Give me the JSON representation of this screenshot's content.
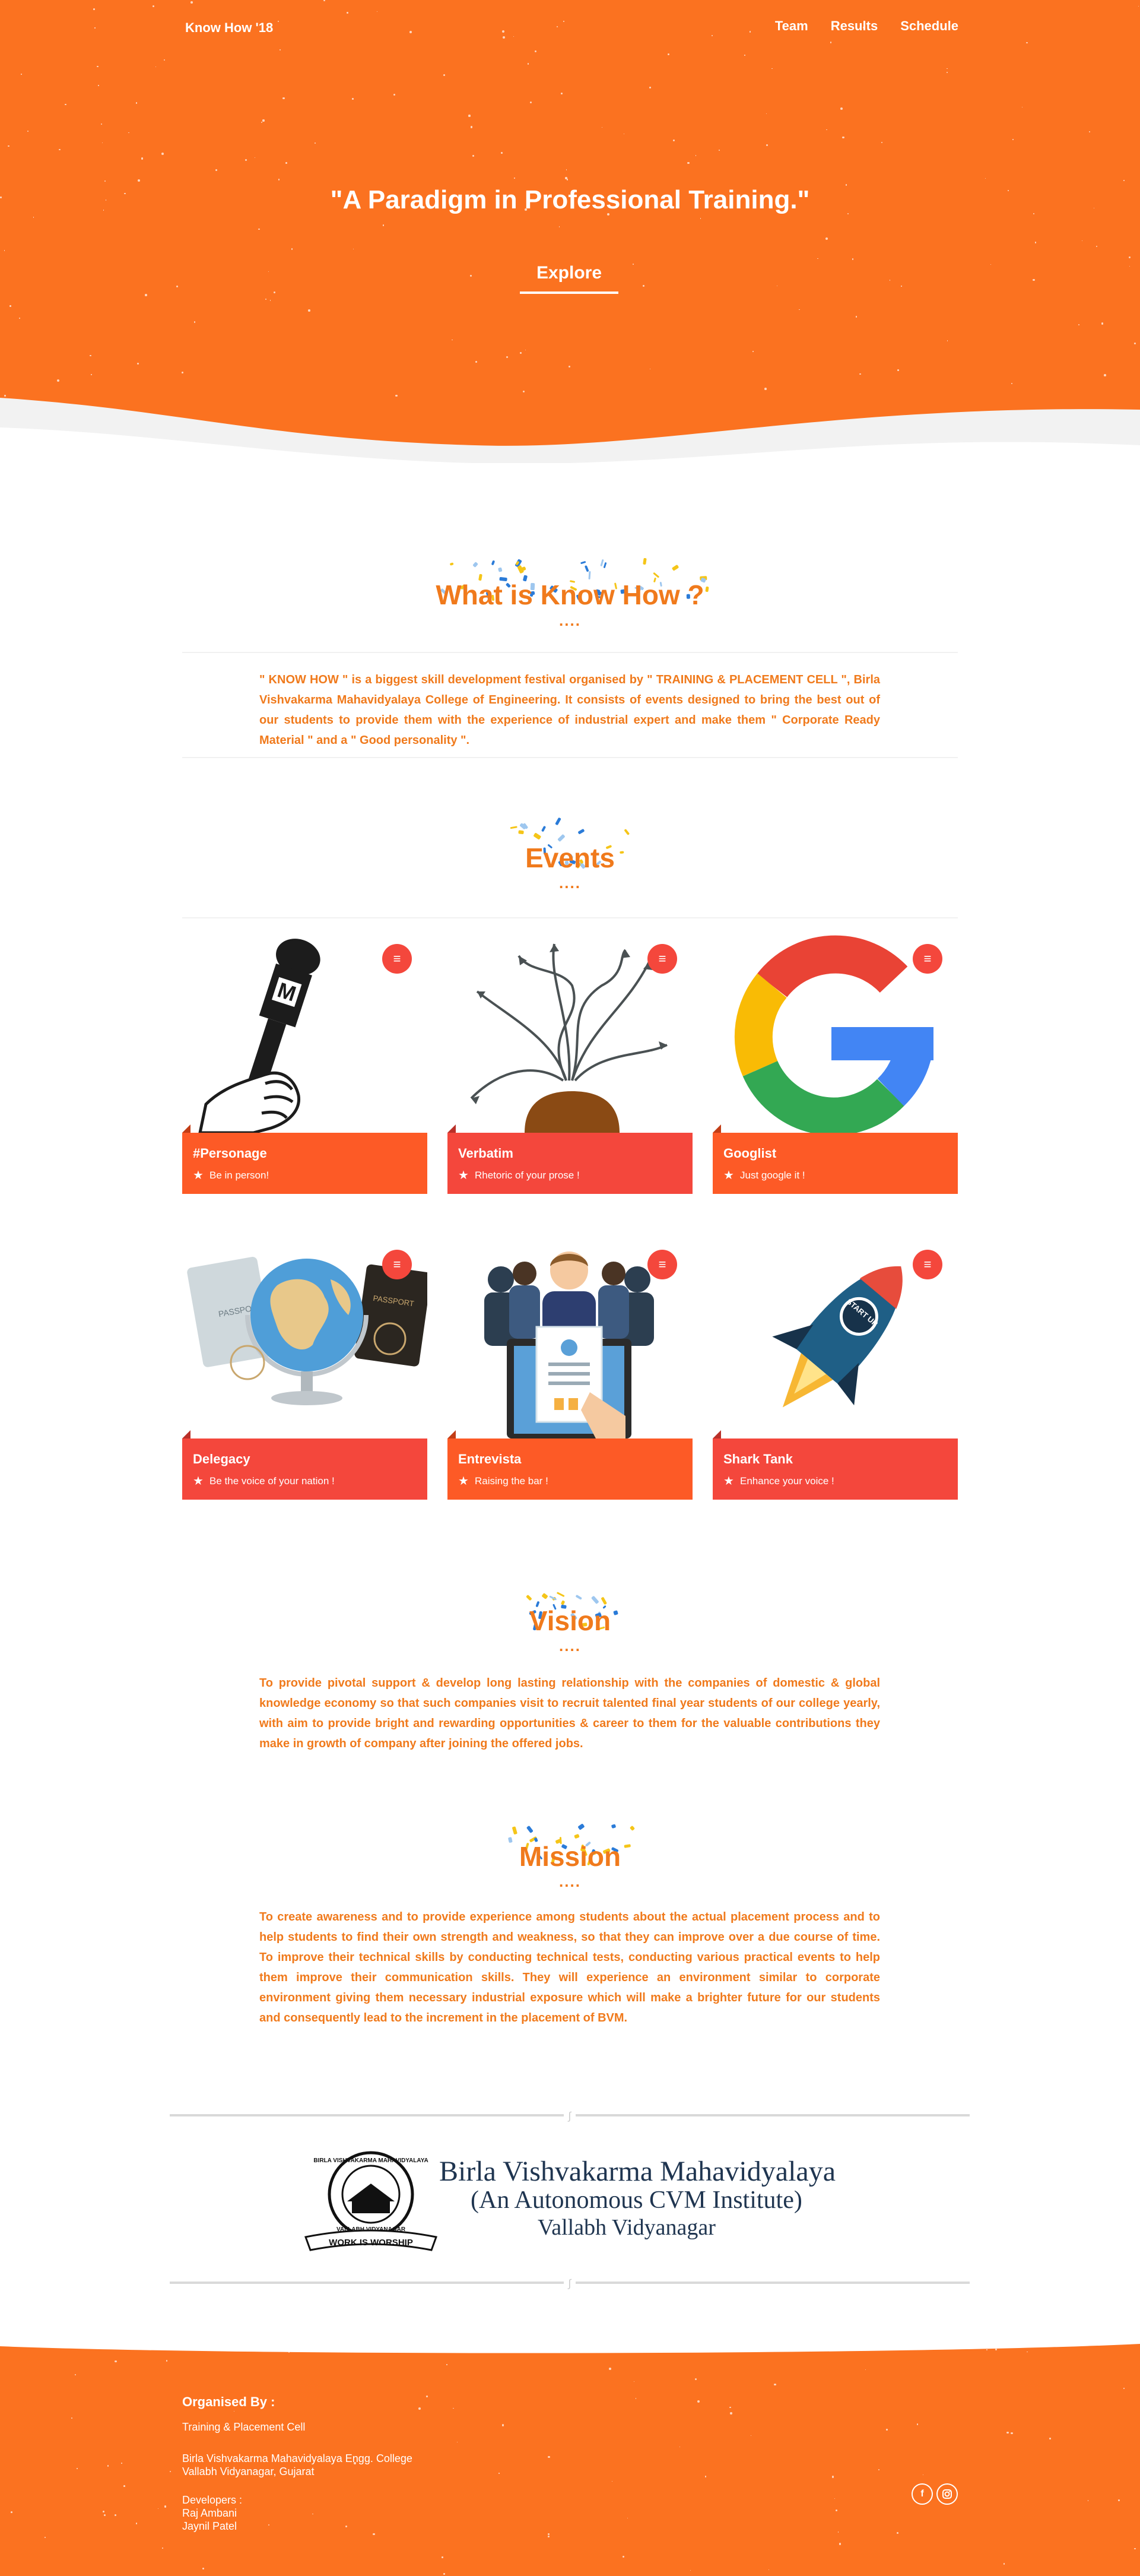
{
  "nav": {
    "brand": "Know How '18",
    "links": [
      "Team",
      "Results",
      "Schedule"
    ]
  },
  "hero": {
    "tagline": "\"A Paradigm in Professional Training.\"",
    "explore": "Explore"
  },
  "about": {
    "title": "What is Know How ?",
    "dots": "....",
    "text": "\" KNOW HOW \" is a biggest skill development festival organised by \" TRAINING & PLACEMENT CELL \", Birla Vishvakarma Mahavidyalaya College of Engineering. It consists of events designed to bring the best out of our students to provide them with the experience of industrial expert and make them \" Corporate Ready Material \" and a \" Good personality \"."
  },
  "events": {
    "title": "Events",
    "dots": "....",
    "items": [
      {
        "title": "#Personage",
        "subtitle": "Be in person!"
      },
      {
        "title": "Verbatim",
        "subtitle": "Rhetoric of your prose !"
      },
      {
        "title": "Googlist",
        "subtitle": "Just google it !"
      },
      {
        "title": "Delegacy",
        "subtitle": "Be the voice of your nation !"
      },
      {
        "title": "Entrevista",
        "subtitle": "Raising the bar !"
      },
      {
        "title": "Shark Tank",
        "subtitle": "Enhance your voice !"
      }
    ],
    "image_labels": {
      "passport": "PASSPORT",
      "startup": "START UP"
    }
  },
  "vision": {
    "title": "Vision",
    "dots": "....",
    "text": "To provide pivotal support & develop long lasting relationship with the companies of domestic & global knowledge economy so that such companies visit to recruit talented final year students of our college yearly, with aim to provide bright and rewarding opportunities & career to them for the valuable contributions they make in growth of company after joining the offered jobs."
  },
  "mission": {
    "title": "Mission",
    "dots": "....",
    "text": "To create awareness and to provide experience among students about the actual placement process and to help students to find their own strength and weakness, so that they can improve over a due course of time. To improve their technical skills by conducting technical tests, conducting various practical events to help them improve their communication skills. They will experience an environment similar to corporate environment giving them necessary industrial exposure which will make a brighter future for our students and consequently lead to the increment in the placement of BVM."
  },
  "institute": {
    "line1": "Birla Vishvakarma Mahavidyalaya",
    "line2": "(An Autonomous CVM Institute)",
    "line3": "Vallabh Vidyanagar",
    "seal_top": "BIRLA VISHVAKARMA MAHAVIDYALAYA",
    "seal_bottom": "VALLABH VIDYANAGAR",
    "motto": "WORK IS WORSHIP"
  },
  "footer": {
    "organised_by": "Organised By :",
    "cell": "Training & Placement Cell",
    "college": "Birla Vishvakarma Mahavidyalaya Engg. College",
    "address": "Vallabh Vidyanagar, Gujarat",
    "developers_label": "Developers :",
    "developers": [
      "Raj Ambani",
      "Jaynil Patel"
    ],
    "social": [
      "facebook-icon",
      "instagram-icon"
    ]
  },
  "colors": {
    "orange": "#fb7220",
    "text_orange": "#f07a1c",
    "card_orange": "#fd5a26",
    "card_red": "#f4473c"
  }
}
